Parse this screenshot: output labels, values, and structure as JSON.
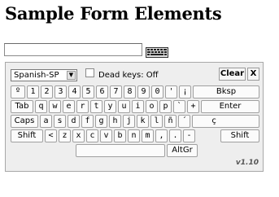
{
  "page": {
    "title": "Sample Form Elements"
  },
  "input": {
    "value": "",
    "keyboard_icon": "keyboard-icon"
  },
  "keyboard": {
    "layout": "Spanish-SP",
    "dead_keys_label": "Dead keys: Off",
    "clear_label": "Clear",
    "close_label": "X",
    "version": "v1.10",
    "row1": [
      "º",
      "1",
      "2",
      "3",
      "4",
      "5",
      "6",
      "7",
      "8",
      "9",
      "0",
      "'",
      "¡",
      "Bksp"
    ],
    "row2": [
      "Tab",
      "q",
      "w",
      "e",
      "r",
      "t",
      "y",
      "u",
      "i",
      "o",
      "p",
      "`",
      "+",
      "Enter"
    ],
    "row3": [
      "Caps",
      "a",
      "s",
      "d",
      "f",
      "g",
      "h",
      "j",
      "k",
      "l",
      "ñ",
      "´",
      "ç"
    ],
    "row4": [
      "Shift",
      "<",
      "z",
      "x",
      "c",
      "v",
      "b",
      "n",
      "m",
      ",",
      ".",
      "-",
      "Shift"
    ],
    "row5": [
      "AltGr"
    ]
  }
}
